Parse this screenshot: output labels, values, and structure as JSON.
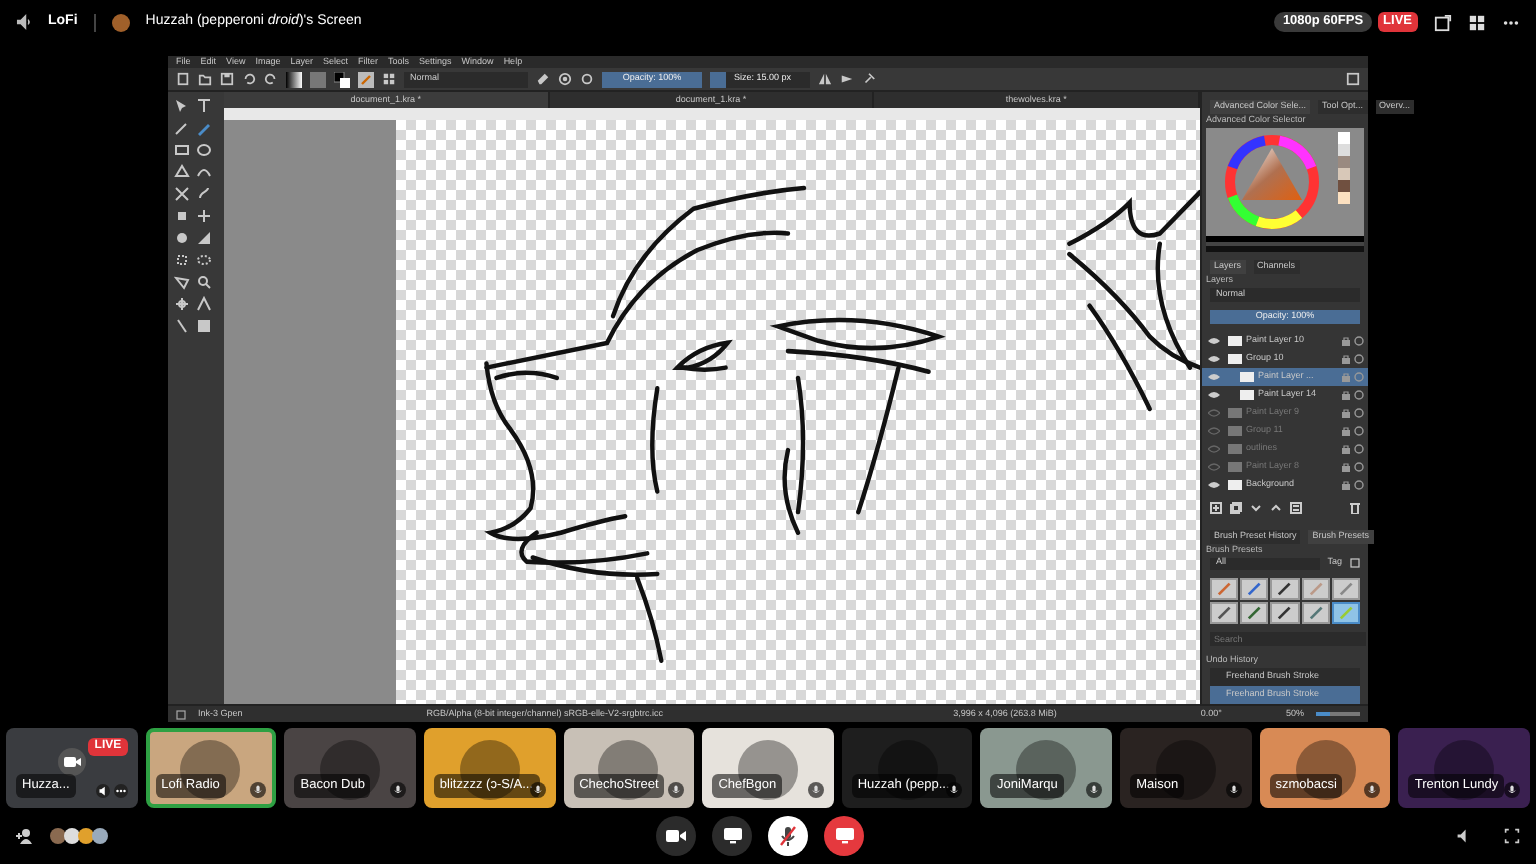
{
  "header": {
    "channel": "LoFi",
    "stream_title": "Huzzah (pepperoni *droid*)'s Screen",
    "quality": "1080p 60FPS",
    "live": "LIVE"
  },
  "krita": {
    "menu": [
      "File",
      "Edit",
      "View",
      "Image",
      "Layer",
      "Select",
      "Filter",
      "Tools",
      "Settings",
      "Window",
      "Help"
    ],
    "toolbar": {
      "blend_mode": "Normal",
      "opacity": {
        "text": "Opacity: 100%",
        "level": 1
      },
      "size": {
        "text": "Size: 15.00 px",
        "level": 0.15
      }
    },
    "tabs": [
      {
        "label": "document_1.kra *",
        "selected": true
      },
      {
        "label": "document_1.kra *",
        "selected": false
      },
      {
        "label": "thewolves.kra *",
        "selected": false
      }
    ],
    "dock": {
      "tabs": [
        {
          "label": "Advanced Color Sele...",
          "selected": true
        },
        {
          "label": "Tool Opt...",
          "selected": false
        },
        {
          "label": "Overv...",
          "selected": false
        }
      ],
      "color_title": "Advanced Color Selector",
      "layer_tabs": [
        {
          "label": "Layers",
          "selected": true
        },
        {
          "label": "Channels",
          "selected": false
        }
      ],
      "layers_title": "Layers",
      "blend_mode": "Normal",
      "opacity": "Opacity: 100%",
      "layers": [
        {
          "name": "Paint Layer 10",
          "visible": true,
          "selected": false
        },
        {
          "name": "Group 10",
          "visible": true,
          "selected": false,
          "children": [
            {
              "name": "Paint Layer ...",
              "visible": true,
              "selected": true
            },
            {
              "name": "Paint Layer 14",
              "visible": true,
              "selected": false
            }
          ]
        },
        {
          "name": "Paint Layer 9",
          "visible": false,
          "selected": false
        },
        {
          "name": "Group 11",
          "visible": false,
          "selected": false
        },
        {
          "name": "outlines",
          "visible": false,
          "selected": false
        },
        {
          "name": "Paint Layer 8",
          "visible": false,
          "selected": false
        },
        {
          "name": "Background",
          "visible": true,
          "selected": false
        }
      ],
      "brush_tabs": [
        {
          "label": "Brush Preset History",
          "selected": false
        },
        {
          "label": "Brush Presets",
          "selected": true
        }
      ],
      "brush_title": "Brush Presets",
      "brush_filter": "All",
      "tag": "Tag",
      "presets": [
        {
          "selected": false
        },
        {
          "selected": false
        },
        {
          "selected": false
        },
        {
          "selected": false
        },
        {
          "selected": false
        },
        {
          "selected": false
        },
        {
          "selected": false
        },
        {
          "selected": false
        },
        {
          "selected": false
        },
        {
          "selected": true
        }
      ],
      "search_placeholder": "Search",
      "undo_title": "Undo History",
      "undo": [
        {
          "label": "Freehand Brush Stroke",
          "selected": false
        },
        {
          "label": "Freehand Brush Stroke",
          "selected": true
        }
      ]
    },
    "status": {
      "brush": "Ink-3 Gpen",
      "color_space": "RGB/Alpha (8-bit integer/channel)  sRGB-elle-V2-srgbtrc.icc",
      "dimensions": "3,996 x 4,096 (263.8 MiB)",
      "rotation": "0.00°",
      "zoom": "50%",
      "zoom_slider": {
        "level": 0.3
      }
    }
  },
  "participants": [
    {
      "kind": "stream",
      "name": "Huzza...",
      "live": "LIVE",
      "color": "#3a3c40",
      "speaking": false
    },
    {
      "kind": "user",
      "name": "Lofi Radio",
      "color": "#c9a67f",
      "speaking": true
    },
    {
      "kind": "user",
      "name": "Bacon Dub",
      "color": "#4a4444",
      "speaking": false
    },
    {
      "kind": "user",
      "name": "blitzzzz (ↄ-S/A...",
      "color": "#e0a02c",
      "speaking": false
    },
    {
      "kind": "user",
      "name": "ChechoStreet",
      "color": "#c8c0b6",
      "speaking": false
    },
    {
      "kind": "user",
      "name": "ChefBgon",
      "color": "#e6e2dc",
      "speaking": false
    },
    {
      "kind": "user",
      "name": "Huzzah (pepp...",
      "color": "#1e1e1e",
      "speaking": false
    },
    {
      "kind": "user",
      "name": "JoniMarqu",
      "color": "#8a9890",
      "speaking": false
    },
    {
      "kind": "user",
      "name": "Maison",
      "color": "#2a2321",
      "speaking": false
    },
    {
      "kind": "user",
      "name": "szmobacsi",
      "color": "#d88a55",
      "speaking": false
    },
    {
      "kind": "user",
      "name": "Trenton Lundy",
      "color": "#3a2050",
      "speaking": false
    }
  ],
  "controls": {
    "muted": true
  }
}
